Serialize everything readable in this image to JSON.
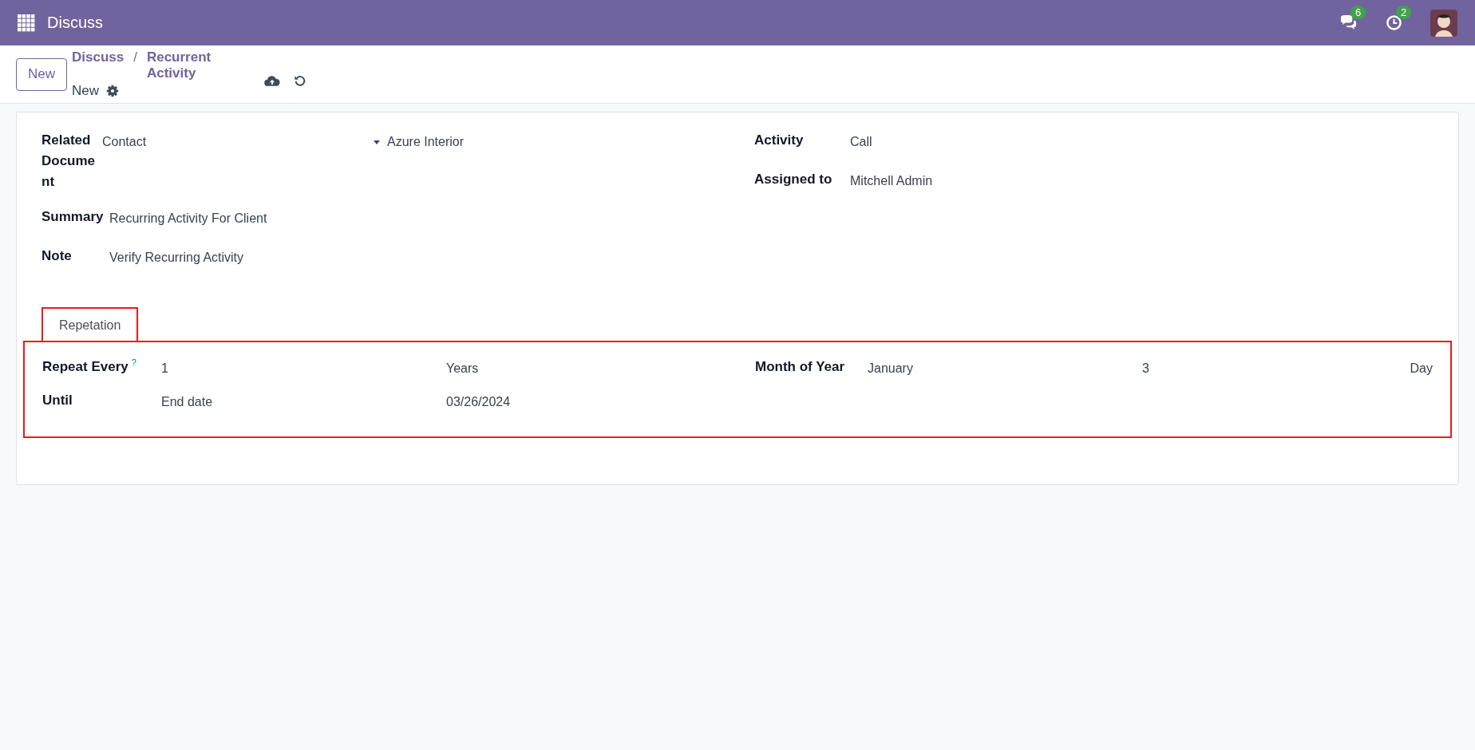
{
  "navbar": {
    "app_name": "Discuss",
    "messages_badge": "6",
    "activities_badge": "2"
  },
  "control_panel": {
    "new_button": "New",
    "breadcrumbs": [
      "Discuss",
      "Recurrent Activity"
    ],
    "separator": "/",
    "record_name": "New"
  },
  "form": {
    "left_fields": [
      {
        "kind": "reference",
        "label": "Related Document",
        "model": "Contact",
        "record": "Azure Interior"
      },
      {
        "kind": "text",
        "label": "Summary",
        "value": "Recurring Activity For Client"
      },
      {
        "kind": "text",
        "label": "Note",
        "value": "Verify Recurring Activity"
      }
    ],
    "right_fields": [
      {
        "kind": "text",
        "label": "Activity",
        "value": "Call"
      },
      {
        "kind": "text",
        "label": "Assigned to",
        "value": "Mitchell Admin"
      }
    ],
    "tabs": [
      {
        "label": "Repetation",
        "selected": true
      }
    ],
    "repetition_left": [
      {
        "label": "Repeat Every",
        "help": "?",
        "values": [
          "1",
          "Years"
        ]
      },
      {
        "label": "Until",
        "values": [
          "End date",
          "03/26/2024"
        ]
      }
    ],
    "repetition_right": [
      {
        "label": "Month of Year",
        "values": [
          "January",
          "3",
          "Day"
        ]
      }
    ]
  }
}
